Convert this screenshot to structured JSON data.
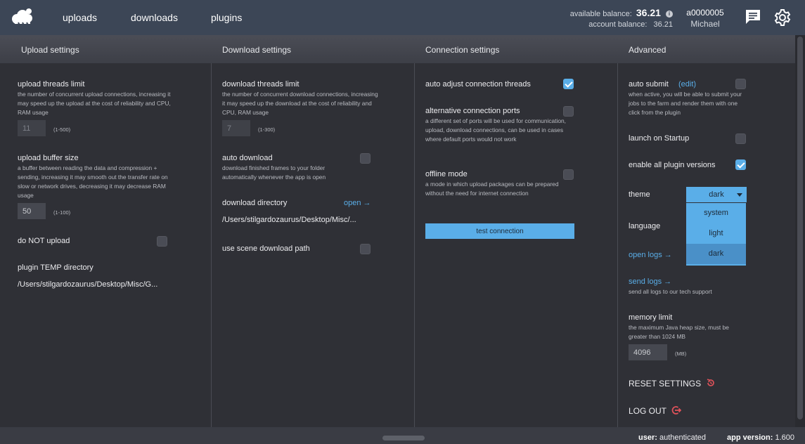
{
  "nav": {
    "uploads": "uploads",
    "downloads": "downloads",
    "plugins": "plugins"
  },
  "balance": {
    "available_label": "available balance:",
    "available_value": "36.21",
    "account_label": "account balance:",
    "account_value": "36.21"
  },
  "account": {
    "id": "a0000005",
    "name": "Michael"
  },
  "sections": {
    "upload": "Upload settings",
    "download": "Download settings",
    "connection": "Connection settings",
    "advanced": "Advanced"
  },
  "upload": {
    "threads_label": "upload threads limit",
    "threads_desc": "the number of concurrent upload connections, increasing it may speed up the upload at the cost of reliability and CPU, RAM usage",
    "threads_value": "11",
    "threads_hint": "(1-500)",
    "buffer_label": "upload buffer size",
    "buffer_desc": "a buffer between reading the data and compression + sending, increasing it may smooth out the transfer rate on slow or network drives, decreasing it may decrease RAM usage",
    "buffer_value": "50",
    "buffer_hint": "(1-100)",
    "no_upload_label": "do NOT upload",
    "no_upload_checked": false,
    "temp_dir_label": "plugin TEMP directory",
    "temp_dir_path": "/Users/stilgardozaurus/Desktop/Misc/G..."
  },
  "download": {
    "threads_label": "download threads limit",
    "threads_desc": "the number of concurrent download connections, increasing it may speed up the download at the cost of reliability and CPU, RAM usage",
    "threads_value": "7",
    "threads_hint": "(1-300)",
    "auto_label": "auto download",
    "auto_desc": "download finished frames to your folder automatically whenever the app is open",
    "auto_checked": false,
    "dir_label": "download directory",
    "dir_open": "open →",
    "dir_path": "/Users/stilgardozaurus/Desktop/Misc/...",
    "scene_path_label": "use scene download path",
    "scene_path_checked": false
  },
  "connection": {
    "auto_adjust_label": "auto adjust connection threads",
    "auto_adjust_checked": true,
    "alt_ports_label": "alternative connection ports",
    "alt_ports_desc": "a different set of ports will be used for communication, upload, download connections, can be used in cases where default ports would not work",
    "alt_ports_checked": false,
    "offline_label": "offline mode",
    "offline_desc": "a mode in which upload packages can be prepared without the need for internet connection",
    "offline_checked": false,
    "test_button": "test connection"
  },
  "advanced": {
    "auto_submit_label": "auto submit",
    "auto_submit_edit": "(edit)",
    "auto_submit_desc": "when active, you will be able to submit your jobs to the farm and render them with one click from the plugin",
    "auto_submit_checked": false,
    "startup_label": "launch on Startup",
    "startup_checked": false,
    "plugin_versions_label": "enable all plugin versions",
    "plugin_versions_checked": true,
    "theme_label": "theme",
    "theme_value": "dark",
    "theme_options": [
      "system",
      "light",
      "dark"
    ],
    "language_label": "language",
    "open_logs": "open logs →",
    "send_logs": "send logs →",
    "send_logs_desc": "send all logs to our tech support",
    "memory_label": "memory limit",
    "memory_desc": "the maximum Java heap size, must be greater than 1024 MB",
    "memory_value": "4096",
    "memory_unit": "(MB)",
    "reset": "RESET SETTINGS",
    "logout": "LOG OUT"
  },
  "footer": {
    "user_label": "user:",
    "user_value": "authenticated",
    "version_label": "app version:",
    "version_value": "1.600"
  },
  "colors": {
    "accent": "#5aaee8",
    "topbar": "#3c4656",
    "background": "#2f3036",
    "danger": "#e0525a"
  },
  "icons": {
    "logo": "cloud-logo-icon",
    "info": "info-icon",
    "messages": "chat-icon",
    "settings": "gear-icon",
    "reset": "reset-icon",
    "logout": "logout-icon"
  }
}
